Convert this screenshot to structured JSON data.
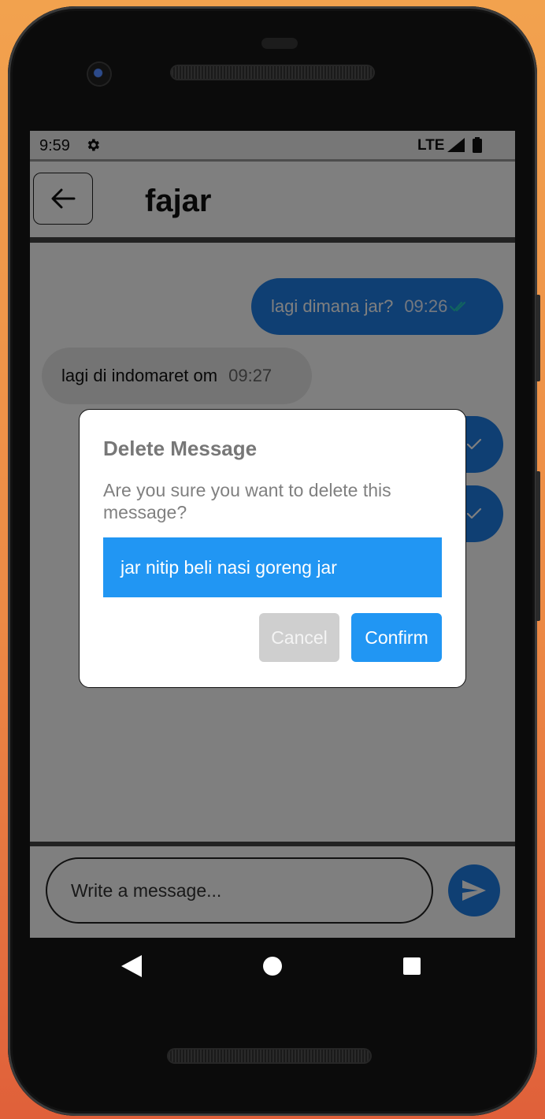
{
  "status_bar": {
    "time": "9:59",
    "network": "LTE",
    "icons": [
      "gear-icon",
      "signal-icon",
      "battery-icon"
    ]
  },
  "app_bar": {
    "back_icon": "arrow-left-icon",
    "title": "fajar"
  },
  "messages": [
    {
      "direction": "sent",
      "text": "lagi dimana jar?",
      "time": "09:26",
      "status_icon": "double-check-icon"
    },
    {
      "direction": "received",
      "text": "lagi di indomaret om",
      "time": "09:27"
    },
    {
      "direction": "sent",
      "text": "",
      "time": "",
      "status_icon": "check-icon"
    },
    {
      "direction": "sent",
      "text": "",
      "time": "",
      "status_icon": "check-icon"
    }
  ],
  "composer": {
    "placeholder": "Write a message...",
    "send_icon": "send-icon"
  },
  "dialog": {
    "title": "Delete Message",
    "body": "Are you sure you want to delete this message?",
    "quoted_message": "jar nitip beli nasi goreng jar",
    "cancel_label": "Cancel",
    "confirm_label": "Confirm"
  },
  "navigation": {
    "icons": [
      "nav-back-icon",
      "nav-home-icon",
      "nav-recents-icon"
    ]
  },
  "colors": {
    "sent_bubble": "#1e7ee6",
    "received_bubble": "#e9e9e9",
    "dialog_accent": "#2196f3",
    "cancel_button": "#cfcfcf",
    "read_tick": "#22c7c0"
  }
}
